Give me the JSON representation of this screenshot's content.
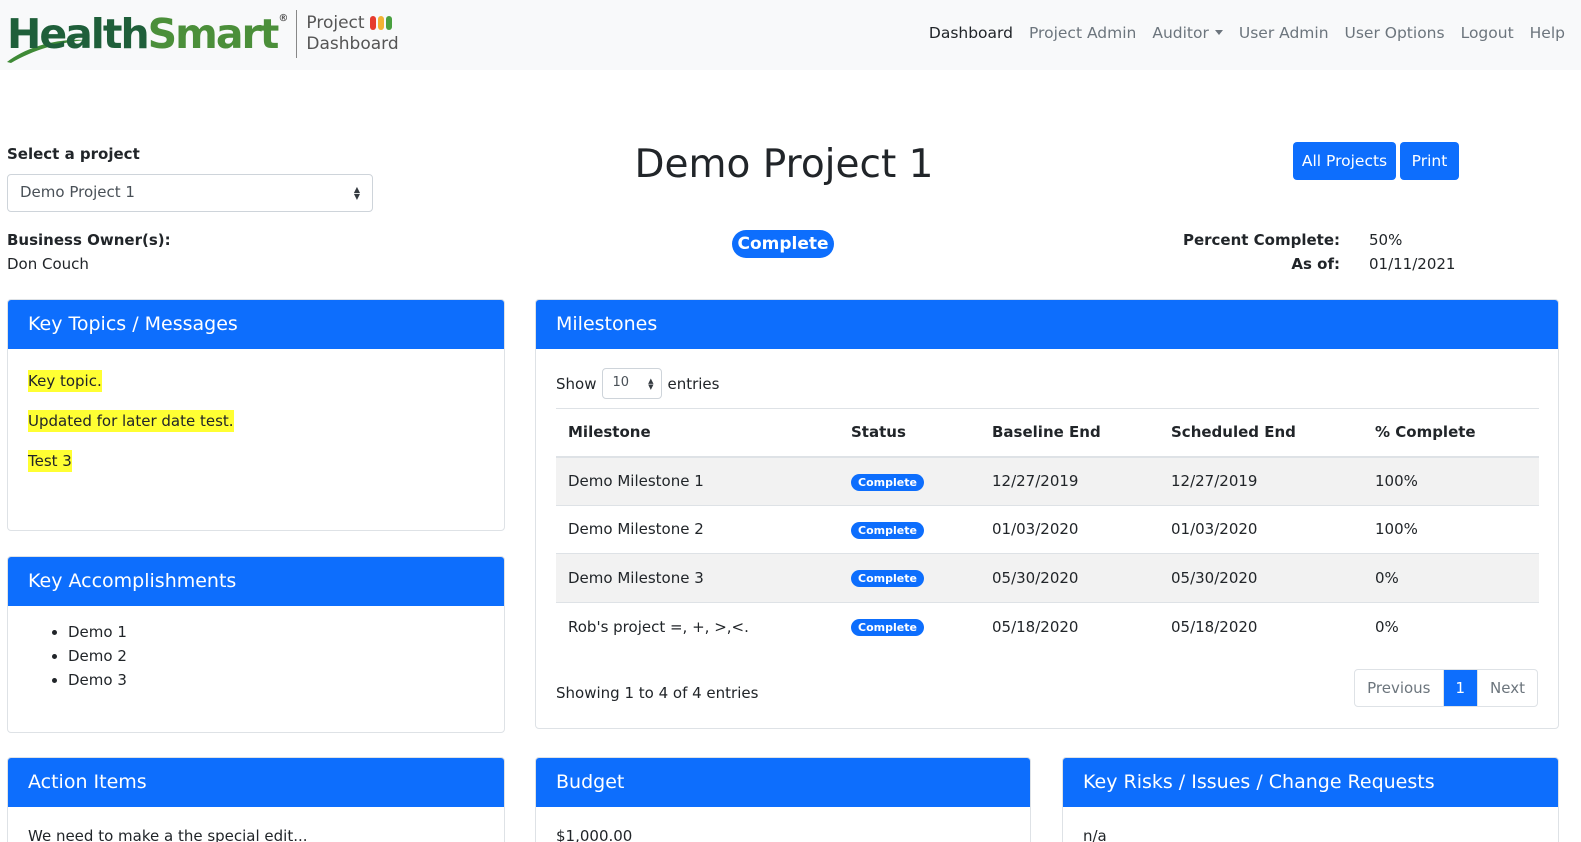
{
  "brand": {
    "name_part1": "Health",
    "name_part2": "Smart",
    "registered": "®",
    "subtitle_line1": "Project",
    "subtitle_line2": "Dashboard",
    "dot_colors": [
      "#e63b2e",
      "#f2b233",
      "#49a03f"
    ]
  },
  "nav": {
    "items": [
      {
        "label": "Dashboard"
      },
      {
        "label": "Project Admin"
      },
      {
        "label": "Auditor"
      },
      {
        "label": "User Admin"
      },
      {
        "label": "User Options"
      },
      {
        "label": "Logout"
      },
      {
        "label": "Help"
      }
    ]
  },
  "project_picker": {
    "label": "Select a project",
    "selected": "Demo Project 1"
  },
  "project": {
    "title": "Demo Project 1",
    "status": "Complete",
    "owner_label": "Business Owner(s):",
    "owner": "Don Couch",
    "percent_label": "Percent Complete:",
    "percent": "50%",
    "asof_label": "As of:",
    "asof": "01/11/2021"
  },
  "buttons": {
    "all_projects": "All Projects",
    "print": "Print"
  },
  "key_topics": {
    "title": "Key Topics / Messages",
    "items": [
      "Key topic.",
      "Updated for later date test.",
      "Test 3"
    ]
  },
  "key_accomplishments": {
    "title": "Key Accomplishments",
    "items": [
      "Demo 1",
      "Demo 2",
      "Demo 3"
    ]
  },
  "milestones": {
    "title": "Milestones",
    "show_label": "Show",
    "entries_label": "entries",
    "page_length": "10",
    "columns": [
      "Milestone",
      "Status",
      "Baseline End",
      "Scheduled End",
      "% Complete"
    ],
    "rows": [
      [
        "Demo Milestone 1",
        "Complete",
        "12/27/2019",
        "12/27/2019",
        "100%"
      ],
      [
        "Demo Milestone 2",
        "Complete",
        "01/03/2020",
        "01/03/2020",
        "100%"
      ],
      [
        "Demo Milestone 3",
        "Complete",
        "05/30/2020",
        "05/30/2020",
        "0%"
      ],
      [
        "Rob's project =, +, >,<.",
        "Complete",
        "05/18/2020",
        "05/18/2020",
        "0%"
      ]
    ],
    "info": "Showing 1 to 4 of 4 entries",
    "pager": {
      "previous": "Previous",
      "current": "1",
      "next": "Next"
    }
  },
  "action_items": {
    "title": "Action Items",
    "text": "We need to make a the special edit..."
  },
  "budget": {
    "title": "Budget",
    "text": "$1,000.00"
  },
  "key_risks": {
    "title": "Key Risks / Issues / Change Requests",
    "text": "n/a"
  },
  "colors": {
    "primary": "#0d6efd",
    "highlight": "#ffff33",
    "brand_dark": "#1f5f3a",
    "brand_green": "#4b8f3a"
  }
}
